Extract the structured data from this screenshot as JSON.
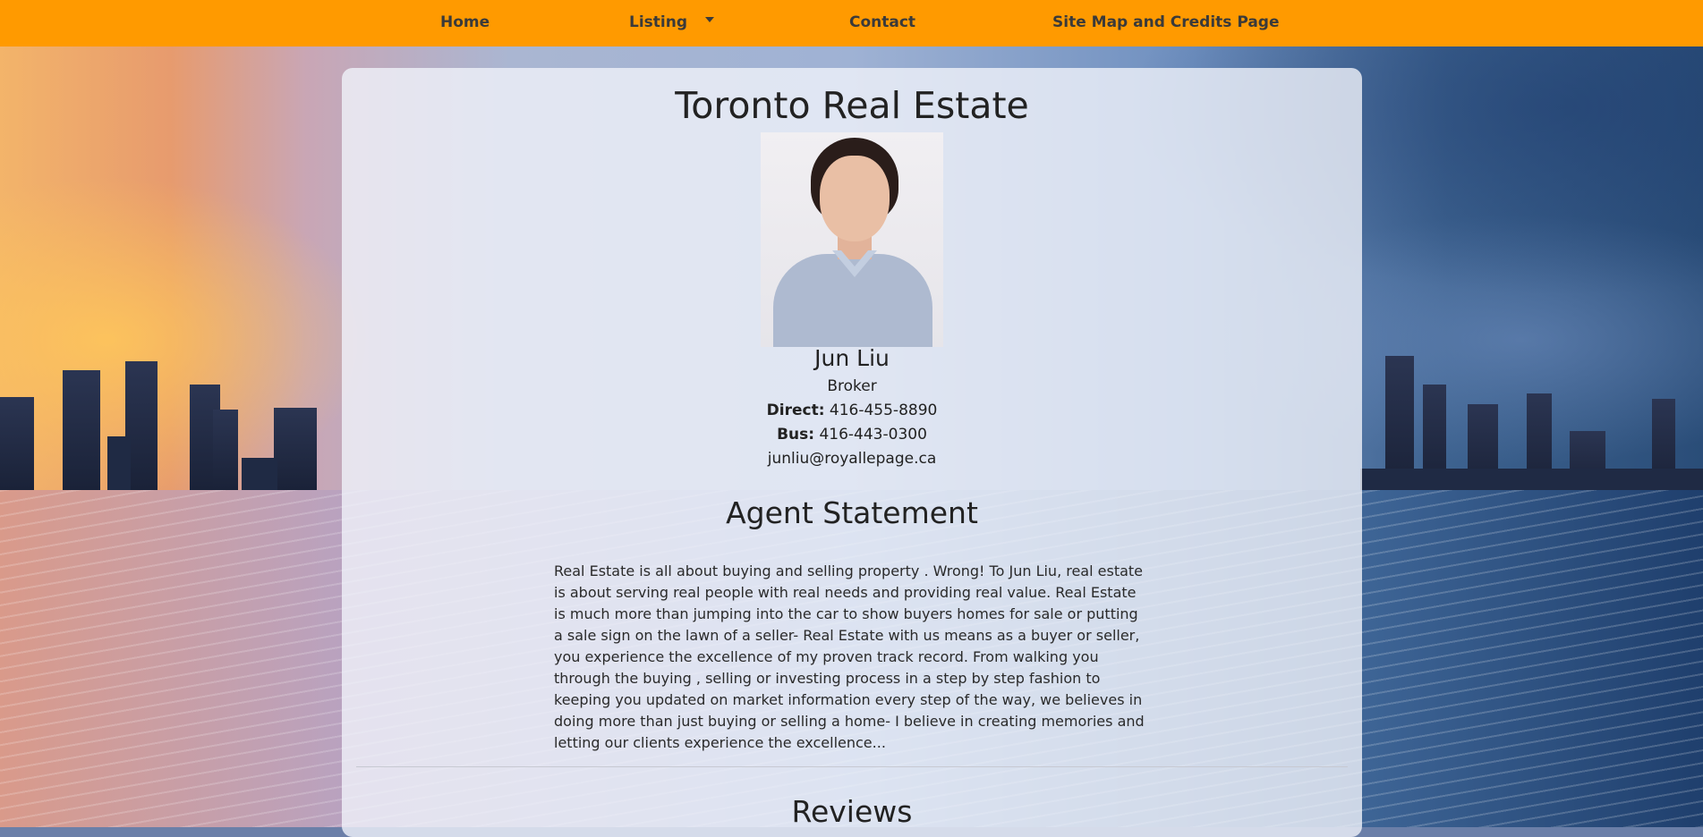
{
  "nav": {
    "items": [
      {
        "label": "Home"
      },
      {
        "label": "Listing"
      },
      {
        "label": "Contact"
      },
      {
        "label": "Site Map and Credits Page"
      }
    ]
  },
  "page": {
    "title": "Toronto Real Estate"
  },
  "agent": {
    "photo_icon": "agent-portrait",
    "name": "Jun Liu",
    "role": "Broker",
    "direct_label": "Direct:",
    "direct_value": "416-455-8890",
    "bus_label": "Bus:",
    "bus_value": "416-443-0300",
    "email": "junliu@royallepage.ca"
  },
  "statement": {
    "title": "Agent Statement",
    "body": "Real Estate is all about buying and selling property . Wrong! To Jun Liu, real estate is about serving real people with real needs and providing real value. Real Estate is much more than jumping into the car to show buyers homes for sale or putting a sale sign on the lawn of a seller- Real Estate with us means as a buyer or seller, you experience the excellence of my proven track record. From walking you through the buying , selling or investing process in a step by step fashion to keeping you updated on market information every step of the way, we believes in doing more than just buying or selling a home- I believe in creating memories and letting our clients experience the excellence..."
  },
  "reviews": {
    "title": "Reviews"
  },
  "colors": {
    "navbar": "#ff9a00",
    "card": "rgba(240,242,250,0.80)"
  }
}
